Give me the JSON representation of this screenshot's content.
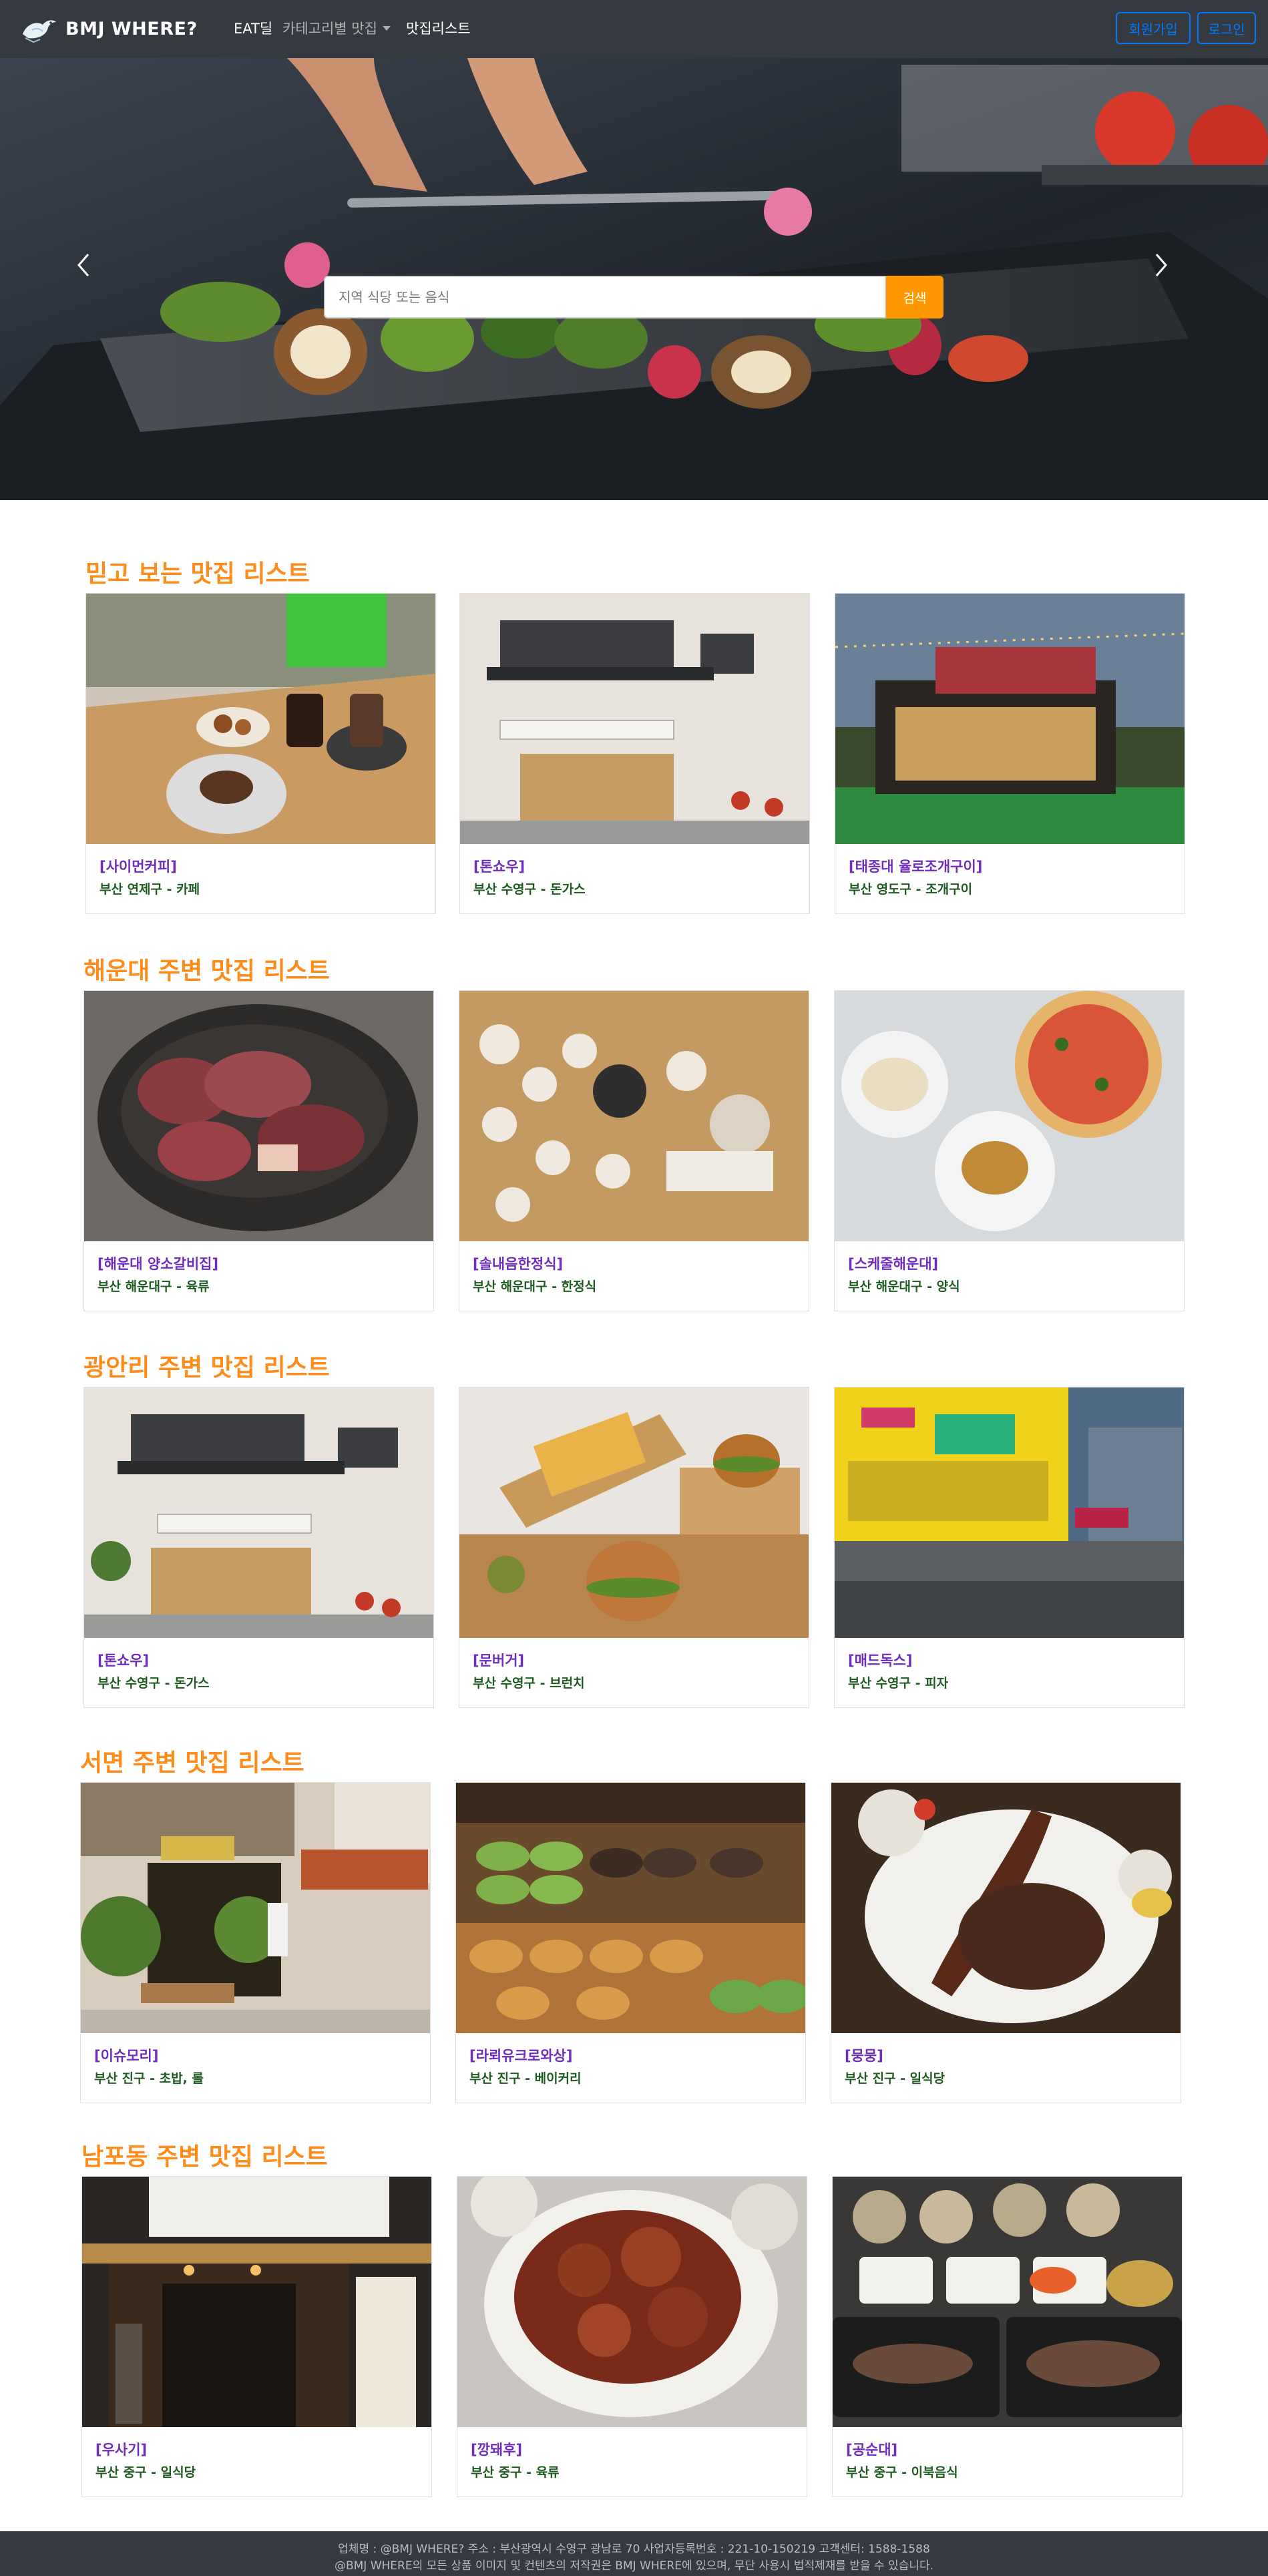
{
  "brand": {
    "name": "BMJ WHERE?",
    "logo_icon": "bird-logo-icon"
  },
  "nav": {
    "eat_deal": "EAT딜",
    "categories": "카테고리별 맛집",
    "list": "맛집리스트",
    "signup": "회원가입",
    "login": "로그인"
  },
  "hero": {
    "search_placeholder": "지역 식당 또는 음식",
    "search_button": "검색",
    "prev_icon": "chevron-left-icon",
    "next_icon": "chevron-right-icon"
  },
  "sections": [
    {
      "title": "믿고 보는 맛집 리스트",
      "cards": [
        {
          "name": "[사이먼커피]",
          "meta": "부산 연제구 - 카페"
        },
        {
          "name": "[톤쇼우]",
          "meta": "부산 수영구 - 돈가스"
        },
        {
          "name": "[태종대 율로조개구이]",
          "meta": "부산 영도구 - 조개구이"
        }
      ]
    },
    {
      "title": "해운대 주변 맛집 리스트",
      "cards": [
        {
          "name": "[해운대 양소갈비집]",
          "meta": "부산 해운대구 - 육류"
        },
        {
          "name": "[솔내음한정식]",
          "meta": "부산 해운대구 - 한정식"
        },
        {
          "name": "[스케줄해운대]",
          "meta": "부산 해운대구 - 양식"
        }
      ]
    },
    {
      "title": "광안리 주변 맛집 리스트",
      "cards": [
        {
          "name": "[톤쇼우]",
          "meta": "부산 수영구 - 돈가스"
        },
        {
          "name": "[문버거]",
          "meta": "부산 수영구 - 브런치"
        },
        {
          "name": "[매드독스]",
          "meta": "부산 수영구 - 피자"
        }
      ]
    },
    {
      "title": "서면 주변 맛집 리스트",
      "cards": [
        {
          "name": "[이슈모리]",
          "meta": "부산 진구 - 초밥, 롤"
        },
        {
          "name": "[라뢰유크로와상]",
          "meta": "부산 진구 - 베이커리"
        },
        {
          "name": "[뭉뭉]",
          "meta": "부산 진구 - 일식당"
        }
      ]
    },
    {
      "title": "남포동 주변 맛집 리스트",
      "cards": [
        {
          "name": "[우사기]",
          "meta": "부산 중구 - 일식당"
        },
        {
          "name": "[깡돼후]",
          "meta": "부산 중구 - 육류"
        },
        {
          "name": "[공순대]",
          "meta": "부산 중구 - 이북음식"
        }
      ]
    }
  ],
  "footer": {
    "line1": "업체명 : @BMJ WHERE? 주소 : 부산광역시 수영구 광남로 70 사업자등록번호 : 221-10-150219 고객센터: 1588-1588",
    "line2": "@BMJ WHERE의 모든 상품 이미지 및 컨텐츠의 저작권은 BMJ WHERE에 있으며, 무단 사용시 법적제재를 받을 수 있습니다."
  },
  "colors": {
    "navbar": "#343a40",
    "accent_orange": "#ff8c1a",
    "search_button": "#ff9800",
    "outline_blue": "#007bff",
    "card_name": "#6f2dbd",
    "card_meta": "#1f5a22"
  }
}
